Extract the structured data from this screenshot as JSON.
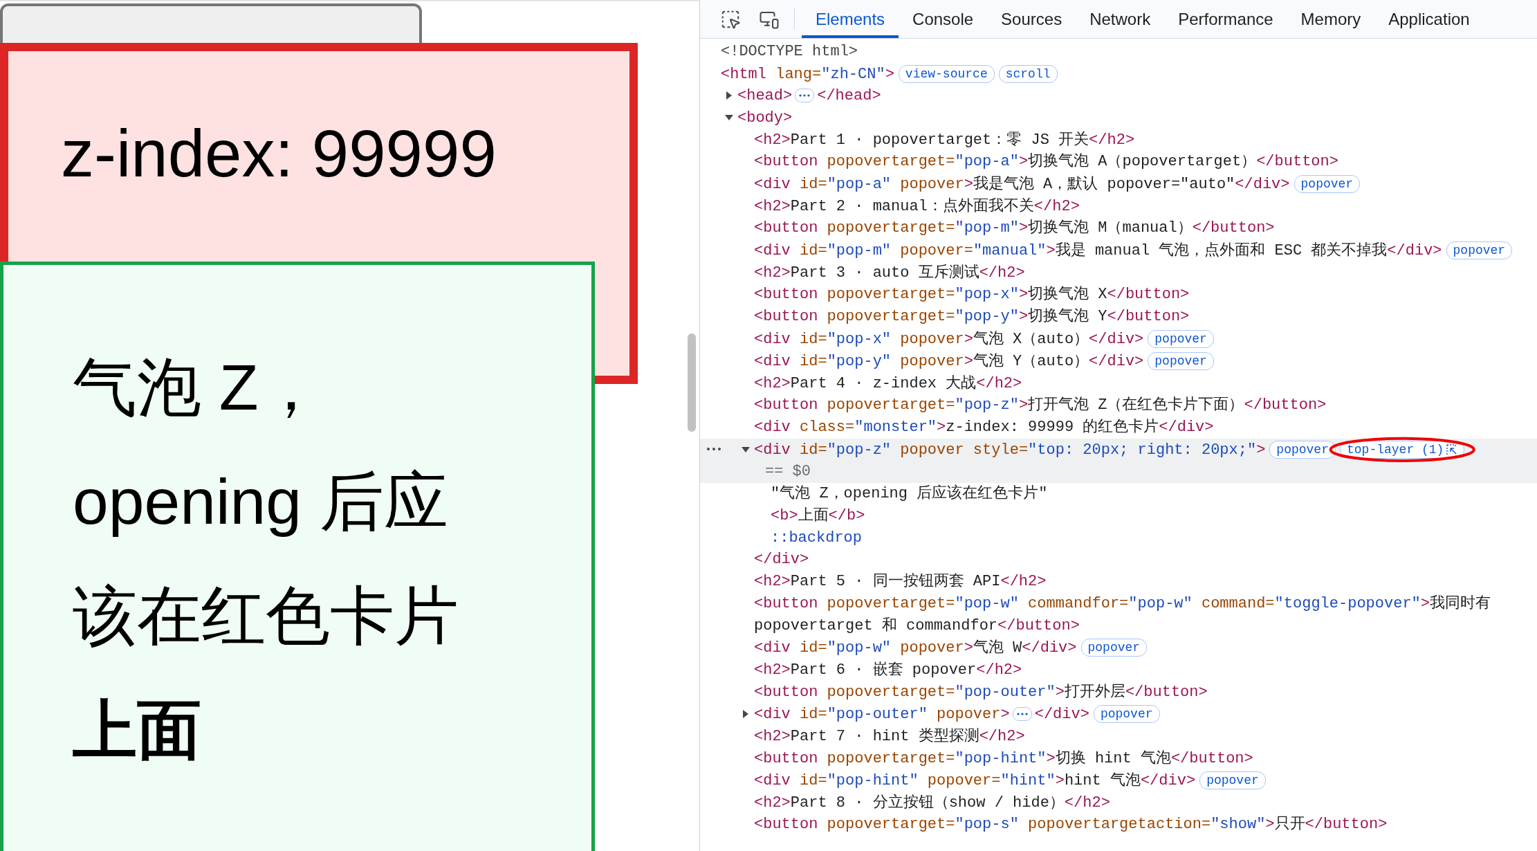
{
  "page": {
    "monster_card": {
      "lines": [
        "z-index: 99999"
      ]
    },
    "popover": {
      "lines": [
        "气泡 Z，",
        "opening 后应",
        "该在红色卡片",
        "**上面**"
      ]
    }
  },
  "devtools": {
    "tabs": [
      {
        "label": "Elements",
        "selected": true
      },
      {
        "label": "Console",
        "selected": false
      },
      {
        "label": "Sources",
        "selected": false
      },
      {
        "label": "Network",
        "selected": false
      },
      {
        "label": "Performance",
        "selected": false
      },
      {
        "label": "Memory",
        "selected": false
      },
      {
        "label": "Application",
        "selected": false
      }
    ],
    "dom_tree": [
      {
        "line": [
          {
            "kind": "doctype",
            "text": "<!DOCTYPE html>"
          }
        ],
        "selected": false
      },
      {
        "line": [
          {
            "kind": "tag",
            "text": "<html"
          },
          {
            "kind": "attr",
            "text": " lang="
          },
          {
            "kind": "value",
            "text": "\"zh-CN\""
          },
          {
            "kind": "tag",
            "text": ">"
          }
        ],
        "selected": false,
        "badges": [
          {
            "label": "view-source",
            "kind": "plain",
            "circled": false
          },
          {
            "label": "scroll",
            "kind": "plain",
            "circled": false
          }
        ],
        "children": [
          {
            "line": [
              {
                "kind": "tag",
                "text": "<head>"
              },
              {
                "kind": "more"
              },
              {
                "kind": "tag",
                "text": "</head>"
              }
            ],
            "selected": false,
            "expanded": false
          },
          {
            "line": [
              {
                "kind": "tag",
                "text": "<body>"
              }
            ],
            "selected": false,
            "expanded": true,
            "children": [
              {
                "line": [
                  {
                    "kind": "tag",
                    "text": "<h2>"
                  },
                  {
                    "kind": "text",
                    "text": "Part 1 · popovertarget：零 JS 开关"
                  },
                  {
                    "kind": "tag",
                    "text": "</h2>"
                  }
                ],
                "selected": false
              },
              {
                "line": [
                  {
                    "kind": "tag",
                    "text": "<button"
                  },
                  {
                    "kind": "attr",
                    "text": " popovertarget="
                  },
                  {
                    "kind": "value",
                    "text": "\"pop-a\""
                  },
                  {
                    "kind": "tag",
                    "text": ">"
                  },
                  {
                    "kind": "text",
                    "text": "切换气泡 A（popovertarget）"
                  },
                  {
                    "kind": "tag",
                    "text": "</button>"
                  }
                ],
                "selected": false
              },
              {
                "line": [
                  {
                    "kind": "tag",
                    "text": "<div"
                  },
                  {
                    "kind": "attr",
                    "text": " id="
                  },
                  {
                    "kind": "value",
                    "text": "\"pop-a\""
                  },
                  {
                    "kind": "attr",
                    "text": " popover"
                  },
                  {
                    "kind": "tag",
                    "text": ">"
                  },
                  {
                    "kind": "text",
                    "text": "我是气泡 A，默认 popover=\"auto\""
                  },
                  {
                    "kind": "tag",
                    "text": "</div>"
                  }
                ],
                "selected": false,
                "badges": [
                  {
                    "label": "popover",
                    "kind": "plain",
                    "circled": false
                  }
                ]
              },
              {
                "line": [
                  {
                    "kind": "tag",
                    "text": "<h2>"
                  },
                  {
                    "kind": "text",
                    "text": "Part 2 · manual：点外面我不关"
                  },
                  {
                    "kind": "tag",
                    "text": "</h2>"
                  }
                ],
                "selected": false
              },
              {
                "line": [
                  {
                    "kind": "tag",
                    "text": "<button"
                  },
                  {
                    "kind": "attr",
                    "text": " popovertarget="
                  },
                  {
                    "kind": "value",
                    "text": "\"pop-m\""
                  },
                  {
                    "kind": "tag",
                    "text": ">"
                  },
                  {
                    "kind": "text",
                    "text": "切换气泡 M（manual）"
                  },
                  {
                    "kind": "tag",
                    "text": "</button>"
                  }
                ],
                "selected": false
              },
              {
                "line": [
                  {
                    "kind": "tag",
                    "text": "<div"
                  },
                  {
                    "kind": "attr",
                    "text": " id="
                  },
                  {
                    "kind": "value",
                    "text": "\"pop-m\""
                  },
                  {
                    "kind": "attr",
                    "text": " popover="
                  },
                  {
                    "kind": "value",
                    "text": "\"manual\""
                  },
                  {
                    "kind": "tag",
                    "text": ">"
                  },
                  {
                    "kind": "text",
                    "text": "我是 manual 气泡，点外面和 ESC 都关不掉我"
                  },
                  {
                    "kind": "tag",
                    "text": "</div>"
                  }
                ],
                "selected": false,
                "badges": [
                  {
                    "label": "popover",
                    "kind": "plain",
                    "circled": false
                  }
                ]
              },
              {
                "line": [
                  {
                    "kind": "tag",
                    "text": "<h2>"
                  },
                  {
                    "kind": "text",
                    "text": "Part 3 · auto 互斥测试"
                  },
                  {
                    "kind": "tag",
                    "text": "</h2>"
                  }
                ],
                "selected": false
              },
              {
                "line": [
                  {
                    "kind": "tag",
                    "text": "<button"
                  },
                  {
                    "kind": "attr",
                    "text": " popovertarget="
                  },
                  {
                    "kind": "value",
                    "text": "\"pop-x\""
                  },
                  {
                    "kind": "tag",
                    "text": ">"
                  },
                  {
                    "kind": "text",
                    "text": "切换气泡 X"
                  },
                  {
                    "kind": "tag",
                    "text": "</button>"
                  }
                ],
                "selected": false
              },
              {
                "line": [
                  {
                    "kind": "tag",
                    "text": "<button"
                  },
                  {
                    "kind": "attr",
                    "text": " popovertarget="
                  },
                  {
                    "kind": "value",
                    "text": "\"pop-y\""
                  },
                  {
                    "kind": "tag",
                    "text": ">"
                  },
                  {
                    "kind": "text",
                    "text": "切换气泡 Y"
                  },
                  {
                    "kind": "tag",
                    "text": "</button>"
                  }
                ],
                "selected": false
              },
              {
                "line": [
                  {
                    "kind": "tag",
                    "text": "<div"
                  },
                  {
                    "kind": "attr",
                    "text": " id="
                  },
                  {
                    "kind": "value",
                    "text": "\"pop-x\""
                  },
                  {
                    "kind": "attr",
                    "text": " popover"
                  },
                  {
                    "kind": "tag",
                    "text": ">"
                  },
                  {
                    "kind": "text",
                    "text": "气泡 X（auto）"
                  },
                  {
                    "kind": "tag",
                    "text": "</div>"
                  }
                ],
                "selected": false,
                "badges": [
                  {
                    "label": "popover",
                    "kind": "plain",
                    "circled": false
                  }
                ]
              },
              {
                "line": [
                  {
                    "kind": "tag",
                    "text": "<div"
                  },
                  {
                    "kind": "attr",
                    "text": " id="
                  },
                  {
                    "kind": "value",
                    "text": "\"pop-y\""
                  },
                  {
                    "kind": "attr",
                    "text": " popover"
                  },
                  {
                    "kind": "tag",
                    "text": ">"
                  },
                  {
                    "kind": "text",
                    "text": "气泡 Y（auto）"
                  },
                  {
                    "kind": "tag",
                    "text": "</div>"
                  }
                ],
                "selected": false,
                "badges": [
                  {
                    "label": "popover",
                    "kind": "plain",
                    "circled": false
                  }
                ]
              },
              {
                "line": [
                  {
                    "kind": "tag",
                    "text": "<h2>"
                  },
                  {
                    "kind": "text",
                    "text": "Part 4 · z-index 大战"
                  },
                  {
                    "kind": "tag",
                    "text": "</h2>"
                  }
                ],
                "selected": false
              },
              {
                "line": [
                  {
                    "kind": "tag",
                    "text": "<button"
                  },
                  {
                    "kind": "attr",
                    "text": " popovertarget="
                  },
                  {
                    "kind": "value",
                    "text": "\"pop-z\""
                  },
                  {
                    "kind": "tag",
                    "text": ">"
                  },
                  {
                    "kind": "text",
                    "text": "打开气泡 Z（在红色卡片下面）"
                  },
                  {
                    "kind": "tag",
                    "text": "</button>"
                  }
                ],
                "selected": false
              },
              {
                "line": [
                  {
                    "kind": "tag",
                    "text": "<div"
                  },
                  {
                    "kind": "attr",
                    "text": " class="
                  },
                  {
                    "kind": "value",
                    "text": "\"monster\""
                  },
                  {
                    "kind": "tag",
                    "text": ">"
                  },
                  {
                    "kind": "text",
                    "text": "z-index: 99999 的红色卡片"
                  },
                  {
                    "kind": "tag",
                    "text": "</div>"
                  }
                ],
                "selected": false
              },
              {
                "line": [
                  {
                    "kind": "tag",
                    "text": "<div"
                  },
                  {
                    "kind": "attr",
                    "text": " id="
                  },
                  {
                    "kind": "value",
                    "text": "\"pop-z\""
                  },
                  {
                    "kind": "attr",
                    "text": " popover style="
                  },
                  {
                    "kind": "value",
                    "text": "\"top: 20px; right: 20px;\""
                  },
                  {
                    "kind": "tag",
                    "text": ">"
                  }
                ],
                "selected": true,
                "expanded": true,
                "note": "== $0",
                "badges": [
                  {
                    "label": "popover",
                    "kind": "plain",
                    "circled": false
                  },
                  {
                    "label": "top-layer (1)",
                    "kind": "reveal",
                    "circled": true
                  }
                ],
                "children": [
                  {
                    "line": [
                      {
                        "kind": "text",
                        "text": "\"气泡 Z，opening 后应该在红色卡片\""
                      }
                    ],
                    "selected": false
                  },
                  {
                    "line": [
                      {
                        "kind": "tag",
                        "text": "<b>"
                      },
                      {
                        "kind": "text",
                        "text": "上面"
                      },
                      {
                        "kind": "tag",
                        "text": "</b>"
                      }
                    ],
                    "selected": false
                  },
                  {
                    "line": [
                      {
                        "kind": "pseudo",
                        "text": "::backdrop"
                      }
                    ],
                    "selected": false
                  }
                ],
                "closing": [
                  {
                    "kind": "tag",
                    "text": "</div>"
                  }
                ]
              },
              {
                "line": [
                  {
                    "kind": "tag",
                    "text": "<h2>"
                  },
                  {
                    "kind": "text",
                    "text": "Part 5 · 同一按钮两套 API"
                  },
                  {
                    "kind": "tag",
                    "text": "</h2>"
                  }
                ],
                "selected": false
              },
              {
                "line": [
                  {
                    "kind": "tag",
                    "text": "<button"
                  },
                  {
                    "kind": "attr",
                    "text": " popovertarget="
                  },
                  {
                    "kind": "value",
                    "text": "\"pop-w\""
                  },
                  {
                    "kind": "attr",
                    "text": " commandfor="
                  },
                  {
                    "kind": "value",
                    "text": "\"pop-w\""
                  },
                  {
                    "kind": "attr",
                    "text": " command="
                  },
                  {
                    "kind": "value",
                    "text": "\"toggle-popover\""
                  },
                  {
                    "kind": "tag",
                    "text": ">"
                  },
                  {
                    "kind": "text",
                    "text": "我同时有 popovertarget 和 commandfor"
                  },
                  {
                    "kind": "tag",
                    "text": "</button>"
                  }
                ],
                "selected": false
              },
              {
                "line": [
                  {
                    "kind": "tag",
                    "text": "<div"
                  },
                  {
                    "kind": "attr",
                    "text": " id="
                  },
                  {
                    "kind": "value",
                    "text": "\"pop-w\""
                  },
                  {
                    "kind": "attr",
                    "text": " popover"
                  },
                  {
                    "kind": "tag",
                    "text": ">"
                  },
                  {
                    "kind": "text",
                    "text": "气泡 W"
                  },
                  {
                    "kind": "tag",
                    "text": "</div>"
                  }
                ],
                "selected": false,
                "badges": [
                  {
                    "label": "popover",
                    "kind": "plain",
                    "circled": false
                  }
                ]
              },
              {
                "line": [
                  {
                    "kind": "tag",
                    "text": "<h2>"
                  },
                  {
                    "kind": "text",
                    "text": "Part 6 · 嵌套 popover"
                  },
                  {
                    "kind": "tag",
                    "text": "</h2>"
                  }
                ],
                "selected": false
              },
              {
                "line": [
                  {
                    "kind": "tag",
                    "text": "<button"
                  },
                  {
                    "kind": "attr",
                    "text": " popovertarget="
                  },
                  {
                    "kind": "value",
                    "text": "\"pop-outer\""
                  },
                  {
                    "kind": "tag",
                    "text": ">"
                  },
                  {
                    "kind": "text",
                    "text": "打开外层"
                  },
                  {
                    "kind": "tag",
                    "text": "</button>"
                  }
                ],
                "selected": false
              },
              {
                "line": [
                  {
                    "kind": "tag",
                    "text": "<div"
                  },
                  {
                    "kind": "attr",
                    "text": " id="
                  },
                  {
                    "kind": "value",
                    "text": "\"pop-outer\""
                  },
                  {
                    "kind": "attr",
                    "text": " popover"
                  },
                  {
                    "kind": "tag",
                    "text": ">"
                  },
                  {
                    "kind": "more"
                  },
                  {
                    "kind": "tag",
                    "text": "</div>"
                  }
                ],
                "selected": false,
                "expanded": false,
                "badges": [
                  {
                    "label": "popover",
                    "kind": "plain",
                    "circled": false
                  }
                ]
              },
              {
                "line": [
                  {
                    "kind": "tag",
                    "text": "<h2>"
                  },
                  {
                    "kind": "text",
                    "text": "Part 7 · hint 类型探测"
                  },
                  {
                    "kind": "tag",
                    "text": "</h2>"
                  }
                ],
                "selected": false
              },
              {
                "line": [
                  {
                    "kind": "tag",
                    "text": "<button"
                  },
                  {
                    "kind": "attr",
                    "text": " popovertarget="
                  },
                  {
                    "kind": "value",
                    "text": "\"pop-hint\""
                  },
                  {
                    "kind": "tag",
                    "text": ">"
                  },
                  {
                    "kind": "text",
                    "text": "切换 hint 气泡"
                  },
                  {
                    "kind": "tag",
                    "text": "</button>"
                  }
                ],
                "selected": false
              },
              {
                "line": [
                  {
                    "kind": "tag",
                    "text": "<div"
                  },
                  {
                    "kind": "attr",
                    "text": " id="
                  },
                  {
                    "kind": "value",
                    "text": "\"pop-hint\""
                  },
                  {
                    "kind": "attr",
                    "text": " popover="
                  },
                  {
                    "kind": "value",
                    "text": "\"hint\""
                  },
                  {
                    "kind": "tag",
                    "text": ">"
                  },
                  {
                    "kind": "text",
                    "text": "hint 气泡"
                  },
                  {
                    "kind": "tag",
                    "text": "</div>"
                  }
                ],
                "selected": false,
                "badges": [
                  {
                    "label": "popover",
                    "kind": "plain",
                    "circled": false
                  }
                ]
              },
              {
                "line": [
                  {
                    "kind": "tag",
                    "text": "<h2>"
                  },
                  {
                    "kind": "text",
                    "text": "Part 8 · 分立按钮（show / hide）"
                  },
                  {
                    "kind": "tag",
                    "text": "</h2>"
                  }
                ],
                "selected": false
              },
              {
                "line": [
                  {
                    "kind": "tag",
                    "text": "<button"
                  },
                  {
                    "kind": "attr",
                    "text": " popovertarget="
                  },
                  {
                    "kind": "value",
                    "text": "\"pop-s\""
                  },
                  {
                    "kind": "attr",
                    "text": " popovertargetaction="
                  },
                  {
                    "kind": "value",
                    "text": "\"show\""
                  },
                  {
                    "kind": "tag",
                    "text": ">"
                  },
                  {
                    "kind": "text",
                    "text": "只开"
                  },
                  {
                    "kind": "tag",
                    "text": "</button>"
                  }
                ],
                "selected": false
              }
            ]
          }
        ]
      }
    ]
  }
}
